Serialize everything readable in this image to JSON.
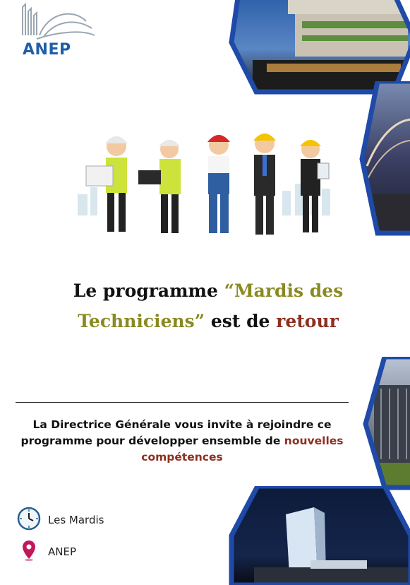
{
  "logo": {
    "text": "ANEP",
    "icon": "building-logo-icon"
  },
  "headline": {
    "part1": "Le programme ",
    "part2": "“Mardis des Techniciens”",
    "part3": " est de ",
    "part4": "retour"
  },
  "invitation": {
    "line": "La Directrice Générale vous invite à rejoindre ce programme pour développer ensemble de ",
    "highlight": "nouvelles compétences"
  },
  "info": [
    {
      "icon": "clock-icon",
      "label": "Les Mardis"
    },
    {
      "icon": "location-pin-icon",
      "label": "ANEP"
    }
  ],
  "colors": {
    "brand_blue": "#1e5fa8",
    "olive": "#8a8a23",
    "dark_red": "#8e2f21",
    "hex_border": "#1f4aa8"
  }
}
